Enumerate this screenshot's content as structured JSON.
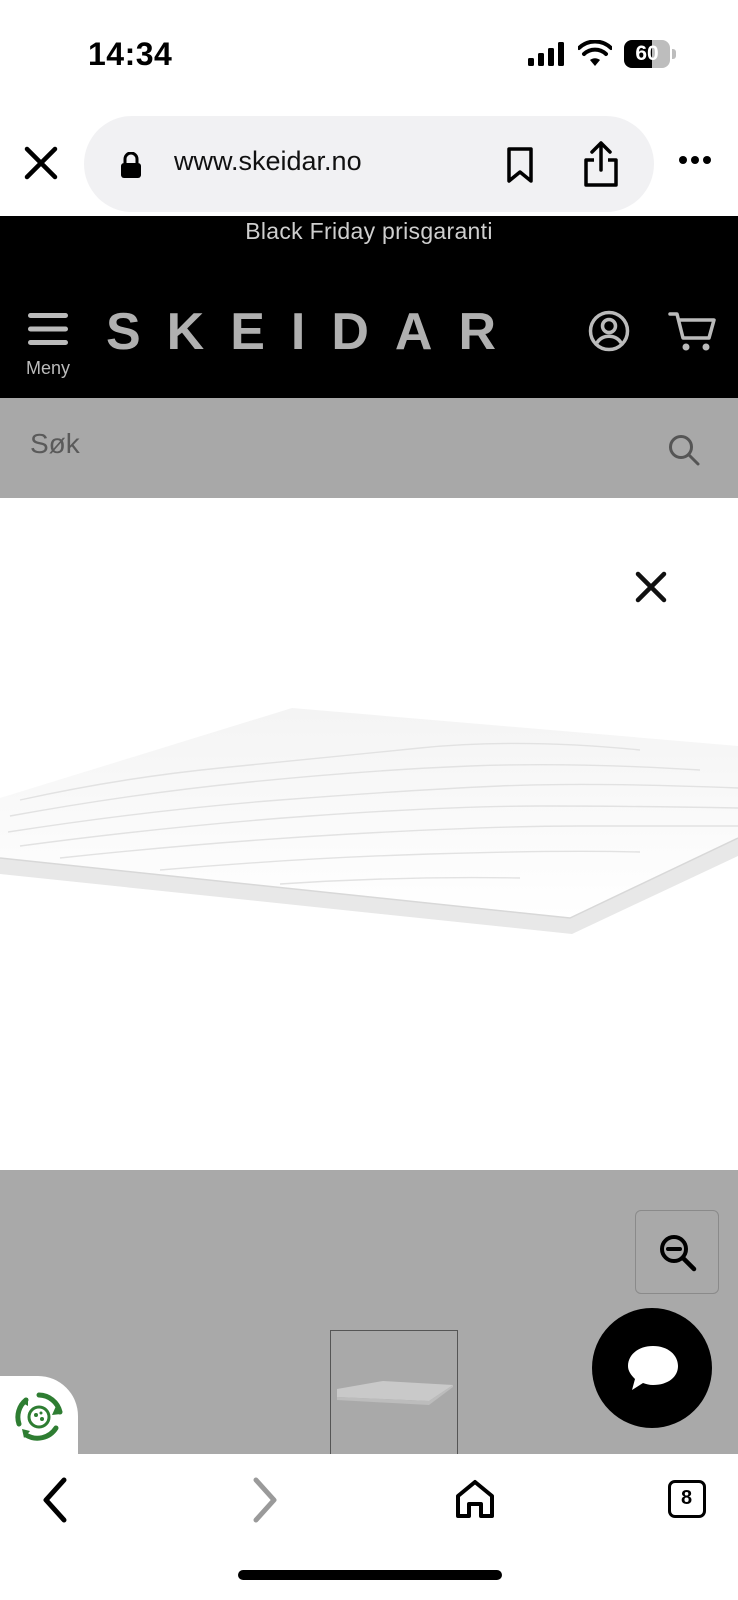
{
  "status_bar": {
    "time": "14:34",
    "battery_level": "60",
    "battery_fraction": 0.6
  },
  "browser": {
    "url": "www.skeidar.no",
    "open_tabs": "8"
  },
  "site": {
    "promo": "Black Friday prisgaranti",
    "menu_label": "Meny",
    "logo": "SKEIDAR",
    "search_placeholder": "Søk"
  },
  "colors": {
    "header_bg": "#000000",
    "search_bg": "#a8a8a8",
    "lower_area_bg": "#a9a9a9",
    "eco_green": "#2e7d32"
  },
  "icons": {
    "status": [
      "signal-icon",
      "wifi-icon",
      "battery-icon"
    ],
    "browser": [
      "close-tab-icon",
      "lock-icon",
      "bookmark-icon",
      "share-icon",
      "more-icon"
    ],
    "header": [
      "menu-icon",
      "account-icon",
      "cart-icon"
    ],
    "page": [
      "search-icon",
      "close-icon",
      "zoom-out-icon",
      "chat-icon",
      "eco-icon"
    ],
    "bottom_nav": [
      "back-icon",
      "forward-icon",
      "home-icon",
      "tabs-icon"
    ]
  }
}
